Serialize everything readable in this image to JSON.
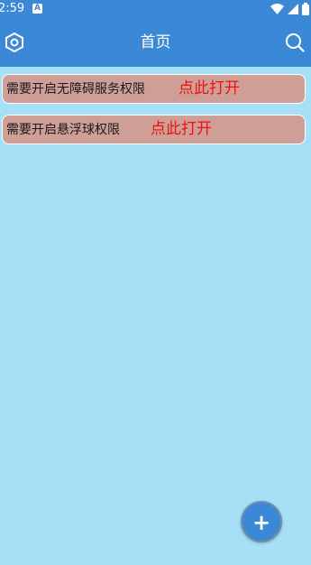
{
  "status": {
    "time": "2:59",
    "notification_icon_label": "A"
  },
  "appbar": {
    "title": "首页",
    "left_icon": "settings-hex-icon",
    "right_icon": "search-icon"
  },
  "cards": [
    {
      "label": "需要开启无障碍服务权限",
      "action": "点此打开"
    },
    {
      "label": "需要开启悬浮球权限",
      "action": "点此打开"
    }
  ],
  "fab": {
    "label": "+"
  },
  "colors": {
    "primary": "#3a88d6",
    "background": "#a6e0f7",
    "card": "#cf9f97",
    "action_text": "#ee1111"
  }
}
